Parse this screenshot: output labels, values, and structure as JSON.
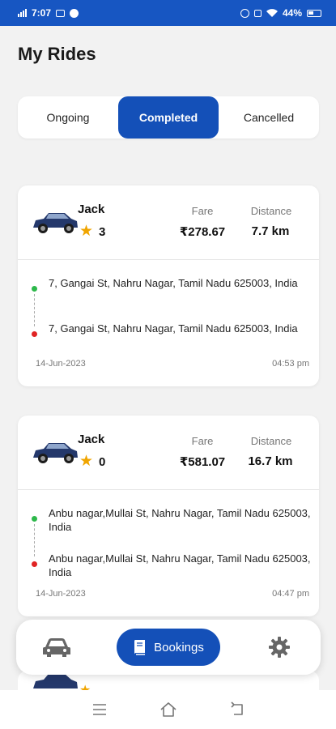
{
  "status_bar": {
    "time": "7:07",
    "battery": "44%",
    "icons": [
      "signal-icon",
      "image-icon",
      "whatsapp-icon",
      "hotspot-icon",
      "volte-icon",
      "wifi-icon",
      "battery-icon"
    ]
  },
  "page": {
    "title": "My Rides"
  },
  "tabs": [
    {
      "label": "Ongoing",
      "active": false
    },
    {
      "label": "Completed",
      "active": true
    },
    {
      "label": "Cancelled",
      "active": false
    }
  ],
  "rides": [
    {
      "driver": "Jack",
      "rating": "3",
      "fare_label": "Fare",
      "fare": "₹278.67",
      "distance_label": "Distance",
      "distance": "7.7 km",
      "pickup": "7, Gangai St, Nahru Nagar, Tamil Nadu 625003, India",
      "drop": "7, Gangai St, Nahru Nagar, Tamil Nadu 625003, India",
      "date": "14-Jun-2023",
      "time": "04:53 pm"
    },
    {
      "driver": "Jack",
      "rating": "0",
      "fare_label": "Fare",
      "fare": "₹581.07",
      "distance_label": "Distance",
      "distance": "16.7 km",
      "pickup": "Anbu nagar,Mullai St, Nahru Nagar, Tamil Nadu 625003, India",
      "drop": "Anbu nagar,Mullai St, Nahru Nagar, Tamil Nadu 625003, India",
      "date": "14-Jun-2023",
      "time": "04:47 pm"
    }
  ],
  "bottom_nav": {
    "bookings_label": "Bookings",
    "active": "bookings",
    "icons": [
      "car-icon",
      "book-icon",
      "gear-icon"
    ]
  },
  "colors": {
    "primary": "#1450b8",
    "status_bar": "#1756c2",
    "star": "#f0a500",
    "pickup_dot": "#2db84b",
    "drop_dot": "#e02424"
  }
}
